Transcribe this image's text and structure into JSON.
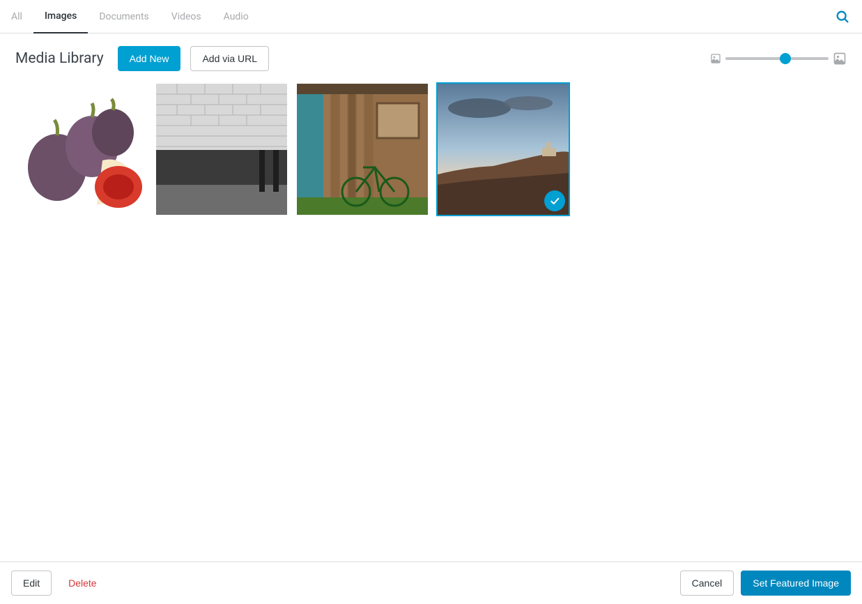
{
  "tabs": [
    {
      "label": "All",
      "active": false
    },
    {
      "label": "Images",
      "active": true
    },
    {
      "label": "Documents",
      "active": false
    },
    {
      "label": "Videos",
      "active": false
    },
    {
      "label": "Audio",
      "active": false
    }
  ],
  "page_title": "Media Library",
  "actions": {
    "add_new": "Add New",
    "add_via_url": "Add via URL"
  },
  "thumbnail_slider": {
    "position_percent": 58
  },
  "media_items": [
    {
      "name": "figs",
      "selected": false
    },
    {
      "name": "bw-wall-water",
      "selected": false
    },
    {
      "name": "barn-bicycle",
      "selected": false
    },
    {
      "name": "city-sunset-hill",
      "selected": true
    }
  ],
  "footer": {
    "edit": "Edit",
    "delete": "Delete",
    "cancel": "Cancel",
    "set_featured": "Set Featured Image"
  }
}
